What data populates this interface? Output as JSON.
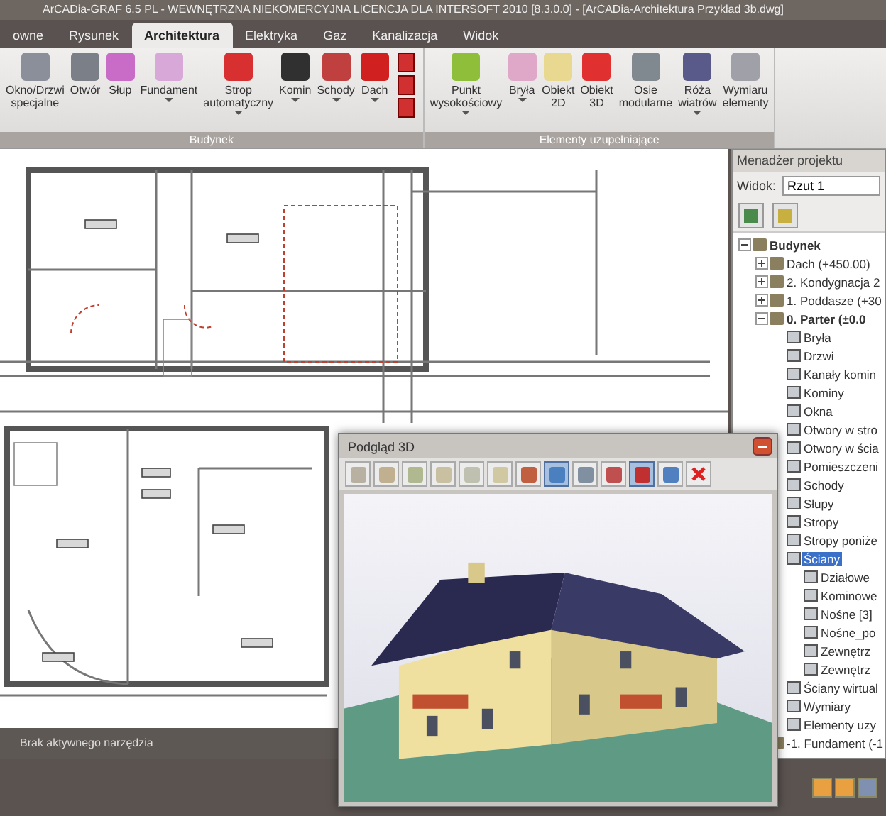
{
  "window": {
    "title": "ArCADia-GRAF 6.5 PL - WEWNĘTRZNA NIEKOMERCYJNA LICENCJA DLA INTERSOFT 2010 [8.3.0.0] - [ArCADia-Architektura Przykład 3b.dwg]"
  },
  "tabs": [
    {
      "label": "owne",
      "selected": false
    },
    {
      "label": "Rysunek",
      "selected": false
    },
    {
      "label": "Architektura",
      "selected": true
    },
    {
      "label": "Elektryka",
      "selected": false
    },
    {
      "label": "Gaz",
      "selected": false
    },
    {
      "label": "Kanalizacja",
      "selected": false
    },
    {
      "label": "Widok",
      "selected": false
    }
  ],
  "ribbon_groups": [
    {
      "title": "Budynek",
      "buttons": [
        {
          "lines": [
            "Okno/Drzwi",
            "specjalne"
          ],
          "dropdown": false
        },
        {
          "lines": [
            "Otwór"
          ],
          "dropdown": false
        },
        {
          "lines": [
            "Słup"
          ],
          "dropdown": false
        },
        {
          "lines": [
            "Fundament"
          ],
          "dropdown": true
        },
        {
          "lines": [
            "Strop",
            "automatyczny"
          ],
          "dropdown": true
        },
        {
          "lines": [
            "Komin"
          ],
          "dropdown": true
        },
        {
          "lines": [
            "Schody"
          ],
          "dropdown": true
        },
        {
          "lines": [
            "Dach"
          ],
          "dropdown": true
        }
      ]
    },
    {
      "title": "Elementy uzupełniające",
      "buttons": [
        {
          "lines": [
            "Punkt",
            "wysokościowy"
          ],
          "dropdown": true
        },
        {
          "lines": [
            "Bryła"
          ],
          "dropdown": true
        },
        {
          "lines": [
            "Obiekt",
            "2D"
          ],
          "dropdown": false
        },
        {
          "lines": [
            "Obiekt",
            "3D"
          ],
          "dropdown": false
        },
        {
          "lines": [
            "Osie",
            "modularne"
          ],
          "dropdown": false
        },
        {
          "lines": [
            "Róża",
            "wiatrów"
          ],
          "dropdown": true
        },
        {
          "lines": [
            "Wymiaru",
            "elementy"
          ],
          "dropdown": false
        }
      ]
    }
  ],
  "project_manager": {
    "title": "Menadżer projektu",
    "view_label": "Widok:",
    "view_value": "Rzut 1",
    "tree": [
      {
        "label": "Budynek",
        "bold": true,
        "expanded": true,
        "selected": false,
        "children": [
          {
            "label": "Dach (+450.00)",
            "bold": false,
            "expanded": false,
            "selected": false
          },
          {
            "label": "2. Kondygnacja 2",
            "bold": false,
            "expanded": false,
            "selected": false
          },
          {
            "label": "1. Poddasze (+30",
            "bold": false,
            "expanded": false,
            "selected": false
          },
          {
            "label": "0. Parter (±0.0",
            "bold": true,
            "expanded": true,
            "selected": false,
            "children": [
              {
                "label": "Bryła",
                "bold": false,
                "selected": false
              },
              {
                "label": "Drzwi",
                "bold": false,
                "selected": false
              },
              {
                "label": "Kanały komin",
                "bold": false,
                "selected": false
              },
              {
                "label": "Kominy",
                "bold": false,
                "selected": false
              },
              {
                "label": "Okna",
                "bold": false,
                "selected": false
              },
              {
                "label": "Otwory w stro",
                "bold": false,
                "selected": false
              },
              {
                "label": "Otwory w ścia",
                "bold": false,
                "selected": false
              },
              {
                "label": "Pomieszczeni",
                "bold": false,
                "selected": false
              },
              {
                "label": "Schody",
                "bold": false,
                "selected": false
              },
              {
                "label": "Słupy",
                "bold": false,
                "selected": false
              },
              {
                "label": "Stropy",
                "bold": false,
                "selected": false
              },
              {
                "label": "Stropy poniże",
                "bold": false,
                "selected": false
              },
              {
                "label": "Ściany",
                "bold": false,
                "selected": true,
                "children": [
                  {
                    "label": "Działowe",
                    "bold": false,
                    "selected": false
                  },
                  {
                    "label": "Kominowe",
                    "bold": false,
                    "selected": false
                  },
                  {
                    "label": "Nośne [3]",
                    "bold": false,
                    "selected": false
                  },
                  {
                    "label": "Nośne_po",
                    "bold": false,
                    "selected": false
                  },
                  {
                    "label": "Zewnętrz",
                    "bold": false,
                    "selected": false
                  },
                  {
                    "label": "Zewnętrz",
                    "bold": false,
                    "selected": false
                  }
                ]
              },
              {
                "label": "Ściany wirtual",
                "bold": false,
                "selected": false
              },
              {
                "label": "Wymiary",
                "bold": false,
                "selected": false
              },
              {
                "label": "Elementy uzy",
                "bold": false,
                "selected": false
              }
            ]
          },
          {
            "label": "-1. Fundament (-1",
            "bold": false,
            "expanded": false,
            "selected": false
          }
        ]
      }
    ]
  },
  "preview_3d": {
    "title": "Podgląd 3D"
  },
  "status_bar": {
    "text": "Brak aktywnego narzędzia"
  }
}
